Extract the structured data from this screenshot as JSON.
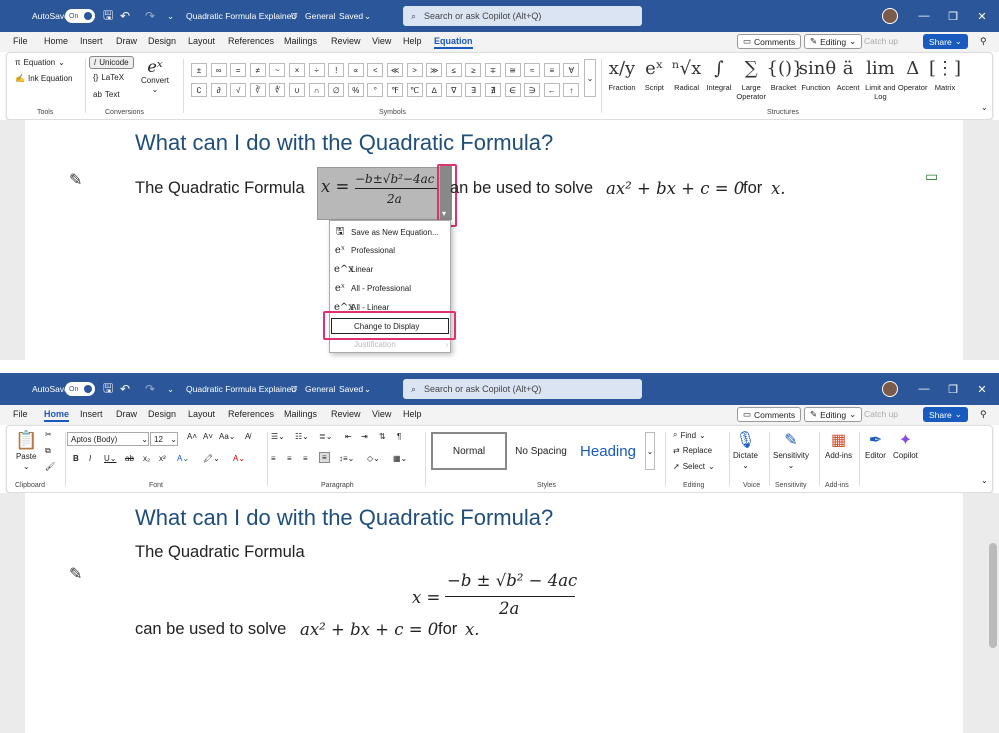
{
  "colors": {
    "titlebar": "#2b579a",
    "accent": "#185abd",
    "heading": "#1f4e79",
    "highlight": "#e0306e"
  },
  "app": {
    "autosave": "AutoSave",
    "autosave_state": "On",
    "doc_title": "Quadratic Formula Explained",
    "sensitivity": "General",
    "saved": "Saved",
    "search_placeholder": "Search or ask Copilot (Alt+Q)"
  },
  "menu_tabs_1": [
    "File",
    "Home",
    "Insert",
    "Draw",
    "Design",
    "Layout",
    "References",
    "Mailings",
    "Review",
    "View",
    "Help",
    "Equation"
  ],
  "menu_tabs_2": [
    "File",
    "Home",
    "Insert",
    "Draw",
    "Design",
    "Layout",
    "References",
    "Mailings",
    "Review",
    "View",
    "Help"
  ],
  "right_buttons": {
    "comments": "Comments",
    "editing": "Editing",
    "catchup": "Catch up",
    "share": "Share"
  },
  "eq_ribbon": {
    "equation": "Equation",
    "ink_equation": "Ink Equation",
    "tools_label": "Tools",
    "unicode": "Unicode",
    "latex": "LaTeX",
    "text": "Text",
    "convert": "Convert",
    "conversions_label": "Conversions",
    "symbols_row1": [
      "±",
      "∞",
      "=",
      "≠",
      "~",
      "×",
      "÷",
      "!",
      "∝",
      "<",
      "≪",
      ">",
      "≫",
      "≤",
      "≥",
      "∓",
      "≅",
      "≈",
      "≡",
      "∀"
    ],
    "symbols_row2": [
      "∁",
      "∂",
      "√",
      "∛",
      "∜",
      "∪",
      "∩",
      "∅",
      "%",
      "°",
      "℉",
      "℃",
      "∆",
      "∇",
      "∃",
      "∄",
      "∈",
      "∋",
      "←",
      "↑"
    ],
    "symbols_label": "Symbols",
    "structures": [
      {
        "icon": "x/y",
        "label": "Fraction"
      },
      {
        "icon": "eˣ",
        "label": "Script"
      },
      {
        "icon": "ⁿ√x",
        "label": "Radical"
      },
      {
        "icon": "∫",
        "label": "Integral"
      },
      {
        "icon": "∑",
        "label": "Large Operator"
      },
      {
        "icon": "{()}",
        "label": "Bracket"
      },
      {
        "icon": "sinθ",
        "label": "Function"
      },
      {
        "icon": "ä",
        "label": "Accent"
      },
      {
        "icon": "lim",
        "label": "Limit and Log"
      },
      {
        "icon": "Δ",
        "label": "Operator"
      },
      {
        "icon": "[⋮]",
        "label": "Matrix"
      }
    ],
    "structures_label": "Structures"
  },
  "home_ribbon": {
    "paste": "Paste",
    "clipboard_label": "Clipboard",
    "font_name": "Aptos (Body)",
    "font_size": "12",
    "font_label": "Font",
    "paragraph_label": "Paragraph",
    "styles": [
      "Normal",
      "No Spacing",
      "Heading"
    ],
    "styles_label": "Styles",
    "find": "Find",
    "replace": "Replace",
    "select": "Select",
    "editing_label": "Editing",
    "dictate": "Dictate",
    "voice_label": "Voice",
    "sensitivity": "Sensitivity",
    "sensitivity_label": "Sensitivity",
    "addins": "Add-ins",
    "addins_label": "Add-ins",
    "editor": "Editor",
    "copilot": "Copilot"
  },
  "doc": {
    "heading": "What can I do with the Quadratic Formula?",
    "sentence_start": "The Quadratic Formula",
    "eq_lhs": "x =",
    "eq_num": "−b ± √b² − 4ac",
    "eq_num_inline": "−b±√b²−4ac",
    "eq_den": "2a",
    "sentence_mid": "an be used to solve",
    "sentence_full2": "can be used to solve",
    "poly": "ax² + bx + c = 0",
    "for_text": "for",
    "var_x": "x."
  },
  "context_menu": {
    "items": [
      "Save as New Equation...",
      "Professional",
      "Linear",
      "All - Professional",
      "All - Linear",
      "Change to Display",
      "Justification"
    ]
  }
}
